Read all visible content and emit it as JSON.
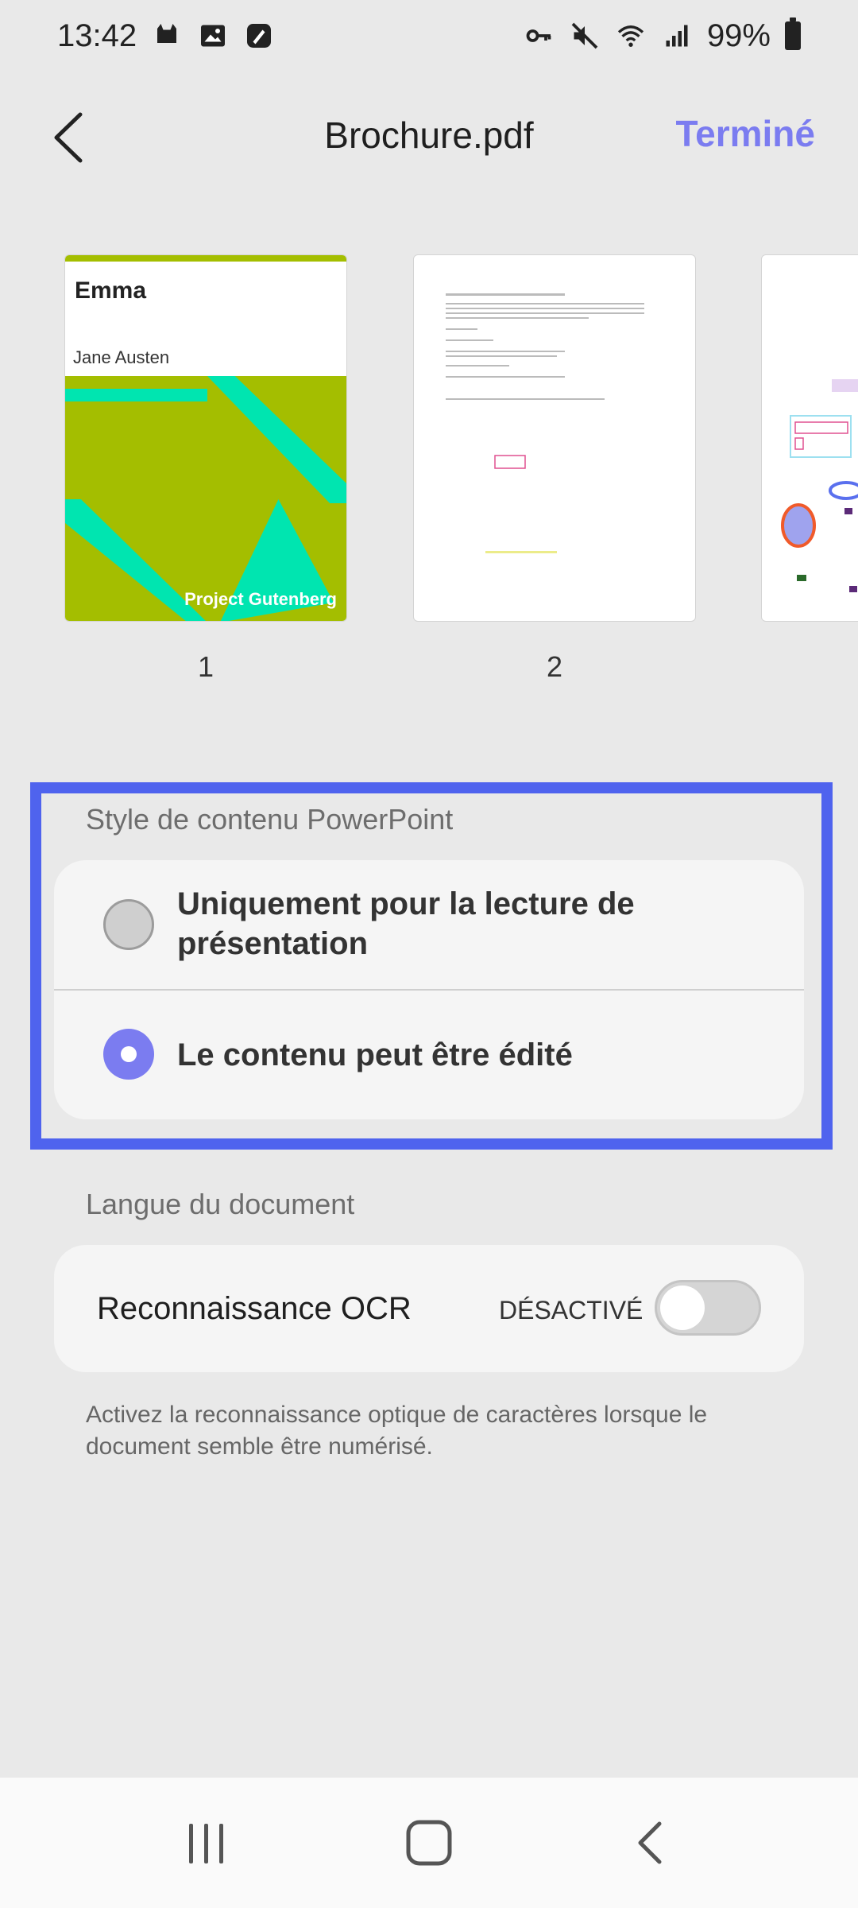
{
  "status_bar": {
    "time": "13:42",
    "battery": "99%"
  },
  "header": {
    "title": "Brochure.pdf",
    "done_label": "Terminé"
  },
  "thumbnails": [
    {
      "page": "1",
      "cover_title": "Emma",
      "cover_author": "Jane Austen",
      "cover_publisher": "Project Gutenberg"
    },
    {
      "page": "2"
    },
    {
      "page": ""
    }
  ],
  "ppt_style": {
    "label": "Style de contenu PowerPoint",
    "options": [
      {
        "line1": "Uniquement pour la lecture de",
        "line2": "présentation",
        "selected": false
      },
      {
        "line1": "Le contenu peut être édité",
        "selected": true
      }
    ]
  },
  "language": {
    "label": "Langue du document",
    "ocr_label": "Reconnaissance OCR",
    "ocr_state": "DÉSACTIVÉ",
    "ocr_enabled": false,
    "help_text": "Activez la reconnaissance optique de caractères lorsque le document semble être numérisé."
  },
  "colors": {
    "accent": "#7b7cf0",
    "highlight": "#4f63ee",
    "cover_green": "#a4be00",
    "cover_teal": "#00e5b0"
  }
}
